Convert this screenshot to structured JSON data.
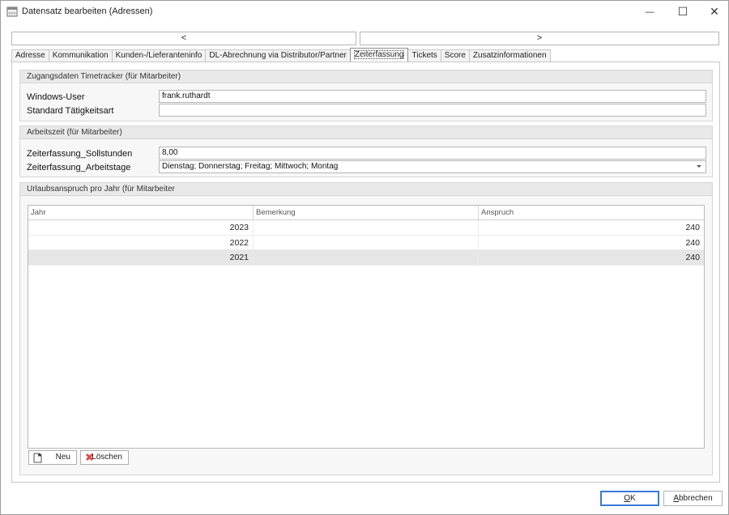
{
  "window": {
    "title": "Datensatz bearbeiten (Adressen)",
    "minimize": "—",
    "maximize": "☐",
    "close": "✕"
  },
  "nav": {
    "prev": "<",
    "next": ">"
  },
  "tabs": [
    {
      "label": "Adresse"
    },
    {
      "label": "Kommunikation"
    },
    {
      "label": "Kunden-/Lieferanteninfo"
    },
    {
      "label": "DL-Abrechnung via Distributor/Partner"
    },
    {
      "label": "Zeiterfassung",
      "active": true
    },
    {
      "label": "Tickets"
    },
    {
      "label": "Score"
    },
    {
      "label": "Zusatzinformationen"
    }
  ],
  "group_timetracker": {
    "header": "Zugangsdaten Timetracker (für Mitarbeiter)",
    "windows_user_label": "Windows-User",
    "windows_user_value": "frank.ruthardt",
    "taetigkeitsart_label": "Standard Tätigkeitsart",
    "taetigkeitsart_value": ""
  },
  "group_arbeitszeit": {
    "header": "Arbeitszeit (für Mitarbeiter)",
    "sollstunden_label": "Zeiterfassung_Sollstunden",
    "sollstunden_value": "8,00",
    "arbeitstage_label": "Zeiterfassung_Arbeitstage",
    "arbeitstage_value": "Dienstag; Donnerstag; Freitag; Mittwoch; Montag"
  },
  "group_urlaub": {
    "header": "Urlaubsanspruch pro Jahr (für Mitarbeiter",
    "columns": [
      "Jahr",
      "Bemerkung",
      "Anspruch"
    ],
    "rows": [
      {
        "jahr": "2023",
        "bemerkung": "",
        "anspruch": "240"
      },
      {
        "jahr": "2022",
        "bemerkung": "",
        "anspruch": "240"
      },
      {
        "jahr": "2021",
        "bemerkung": "",
        "anspruch": "240",
        "selected": true
      }
    ],
    "new_label": "Neu",
    "delete_label": "Löschen"
  },
  "buttons": {
    "ok_prefix": "",
    "ok_mnemonic": "O",
    "ok_rest": "K",
    "cancel_mnemonic": "A",
    "cancel_rest": "bbrechen"
  },
  "colors": {
    "accent": "#3a7bd5",
    "selected_row": "#e6e6e6",
    "delete_icon": "#e0474c"
  }
}
